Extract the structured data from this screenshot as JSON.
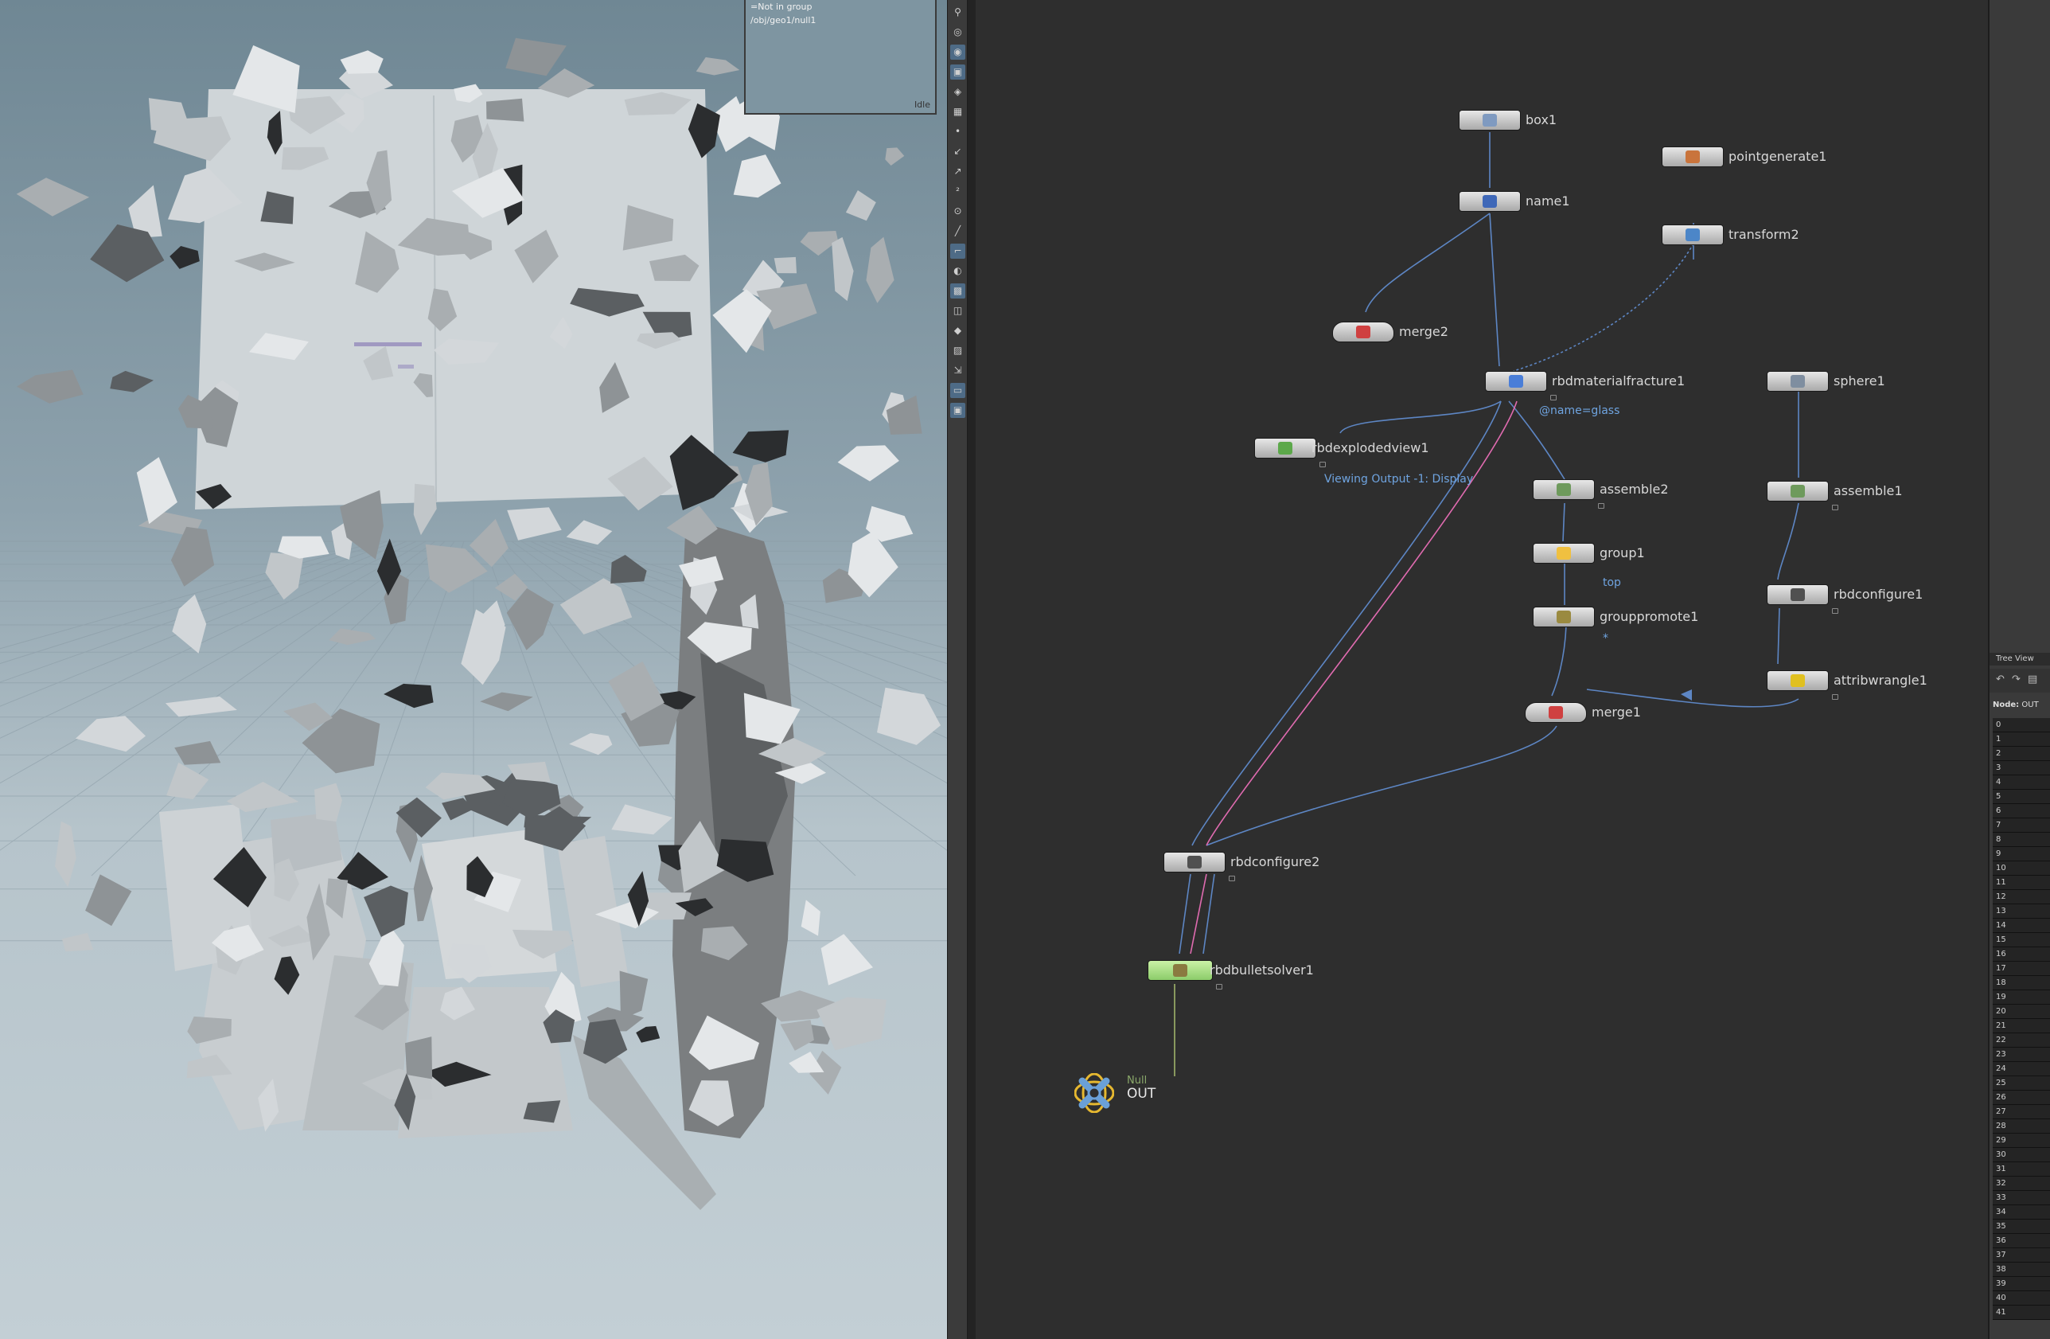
{
  "viewport": {
    "info_lines": [
      "=Not in group",
      "/obj/geo1/null1"
    ],
    "state_label": "Idle"
  },
  "toolbar": {
    "icons": [
      "pin-icon",
      "target-icon",
      "camera-icon",
      "scene-icon",
      "ghost-icon",
      "display-icon",
      "point-icon",
      "normal-icon",
      "primitive-icon",
      "number-icon",
      "vertex-icon",
      "edge-icon",
      "guide-icon",
      "visibility-icon",
      "wireframe-icon",
      "shading-icon",
      "texture-icon",
      "axis-icon",
      "grid-icon",
      "background-icon",
      "snapshot-icon"
    ]
  },
  "network": {
    "nodes": {
      "box1": "box1",
      "name1": "name1",
      "pointgenerate1": "pointgenerate1",
      "transform2": "transform2",
      "merge2": "merge2",
      "rbdmaterialfracture1": "rbdmaterialfracture1",
      "rbdmaterialfracture1_sub": "@name=glass",
      "sphere1": "sphere1",
      "rbdexplodedview1": "rbdexplodedview1",
      "rbdexplodedview1_sub": "Viewing Output -1: Display",
      "assemble2": "assemble2",
      "assemble1": "assemble1",
      "group1": "group1",
      "group1_sub": "top",
      "rbdconfigure1": "rbdconfigure1",
      "grouppromote1": "grouppromote1",
      "grouppromote1_sub": "*",
      "attribwrangle1": "attribwrangle1",
      "merge1": "merge1",
      "rbdconfigure2": "rbdconfigure2",
      "rbdbulletsolver1": "rbdbulletsolver1",
      "out_type": "Null",
      "out": "OUT"
    },
    "colors": {
      "wire": "#5d86c4",
      "pink": "#e06bb0",
      "node_body": "#d6d6d6",
      "bypass": "#a8e07e"
    }
  },
  "tree_view": {
    "tab_label": "Tree View",
    "node_label": "Node:",
    "node_value": "OUT",
    "rows": [
      "0",
      "1",
      "2",
      "3",
      "4",
      "5",
      "6",
      "7",
      "8",
      "9",
      "10",
      "11",
      "12",
      "13",
      "14",
      "15",
      "16",
      "17",
      "18",
      "19",
      "20",
      "21",
      "22",
      "23",
      "24",
      "25",
      "26",
      "27",
      "28",
      "29",
      "30",
      "31",
      "32",
      "33",
      "34",
      "35",
      "36",
      "37",
      "38",
      "39",
      "40",
      "41"
    ]
  }
}
